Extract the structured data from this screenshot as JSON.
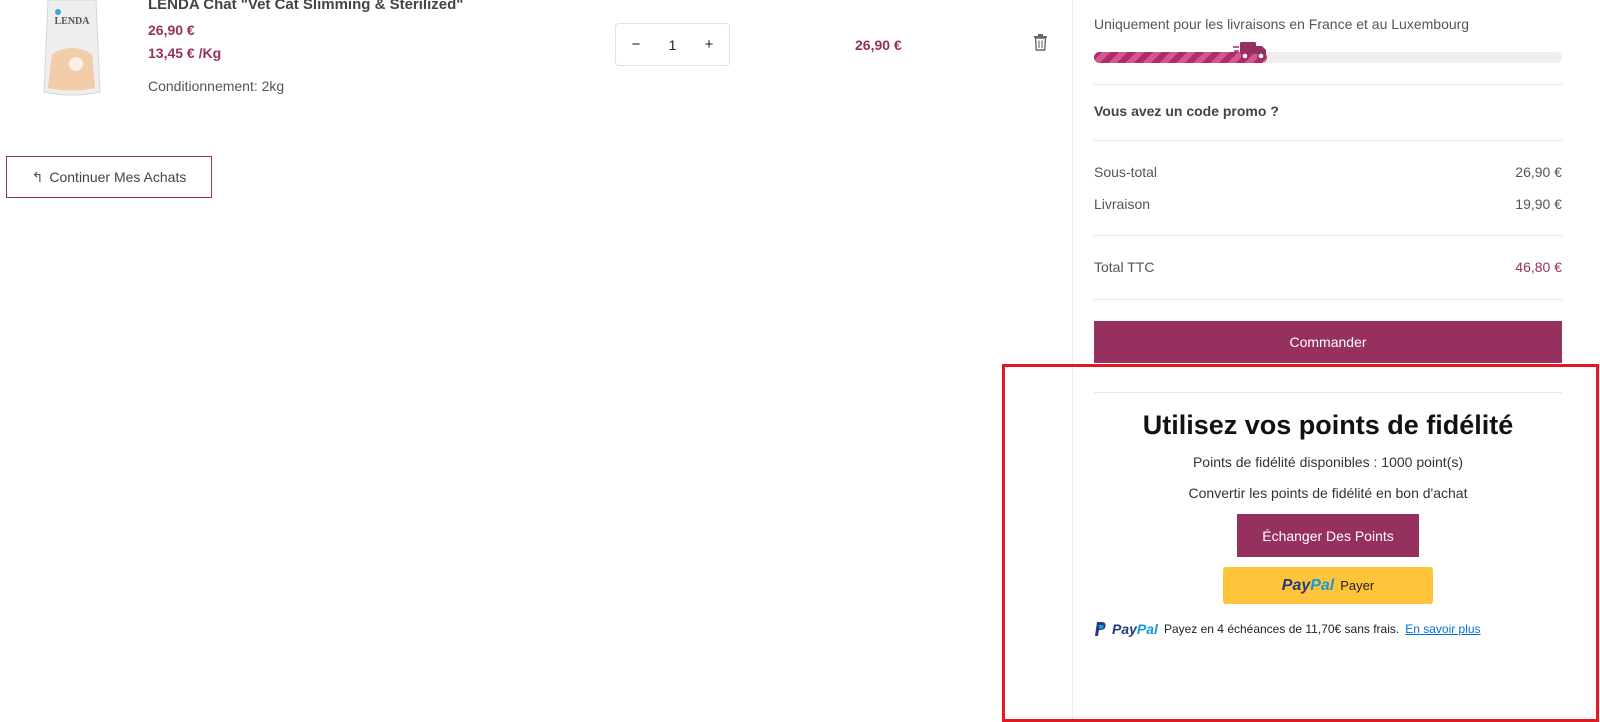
{
  "product": {
    "name": "LENDA Chat \"Vet Cat Slimming & Sterilized\"",
    "image_brand": "LENDA",
    "price": "26,90 €",
    "price_per_kg": "13,45 € /Kg",
    "packaging": "Conditionnement: 2kg",
    "quantity": "1",
    "minus": "−",
    "plus": "+",
    "line_total": "26,90 €",
    "trash_icon": "trash-icon"
  },
  "continue": {
    "icon": "↰",
    "label": "Continuer Mes Achats"
  },
  "summary": {
    "delivery_note": "Uniquement pour les livraisons en France et au Luxembourg",
    "progress_fraction": 0.37,
    "promo_label": "Vous avez un code promo ?",
    "subtotal_label": "Sous-total",
    "subtotal_value": "26,90 €",
    "shipping_label": "Livraison",
    "shipping_value": "19,90 €",
    "total_label": "Total TTC",
    "total_value": "46,80 €",
    "order_button": "Commander"
  },
  "loyalty": {
    "title": "Utilisez vos points de fidélité",
    "points_available": "Points de fidélité disponibles : 1000 point(s)",
    "convert_text": "Convertir les points de fidélité en bon d'achat",
    "exchange_button": "Échanger Des Points"
  },
  "paypal": {
    "brand_pay": "Pay",
    "brand_pal": "Pal",
    "button_label": "Payer",
    "paylater_text": "Payez en 4 échéances de 11,70€ sans frais.",
    "paylater_link": "En savoir plus"
  },
  "colors": {
    "accent": "#96305f",
    "paypal_yellow": "#ffc439",
    "highlight": "#e3191f"
  }
}
